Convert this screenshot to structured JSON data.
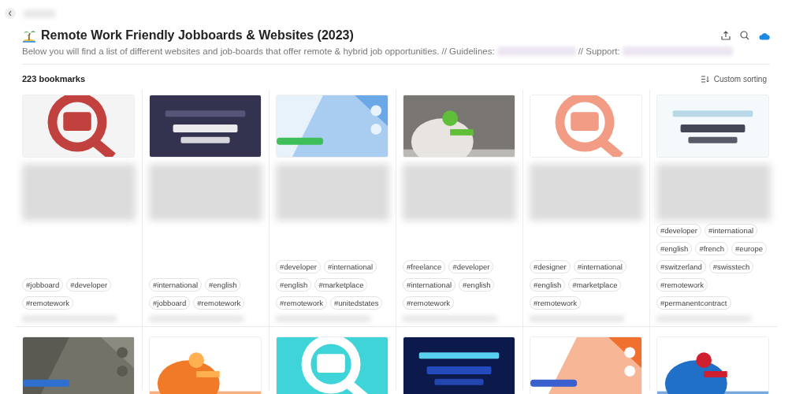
{
  "header": {
    "title": "Remote Work Friendly Jobboards & Websites (2023)",
    "description": "Below you will find a list of different websites and job-boards that offer remote & hybrid job opportunities.",
    "guidelines_label": "// Guidelines:",
    "support_label": "// Support:"
  },
  "toolbar": {
    "count": "223 bookmarks",
    "sort_label": "Custom sorting"
  },
  "rows": [
    {
      "bookmarks": [
        {
          "thumbnail": {
            "kind": "picture"
          },
          "tags": [
            "#jobboard",
            "#developer",
            "#remotework"
          ]
        },
        {
          "thumbnail": {
            "kind": "picture"
          },
          "tags": [
            "#international",
            "#english",
            "#jobboard",
            "#remotework"
          ]
        },
        {
          "thumbnail": {
            "kind": "picture"
          },
          "tags": [
            "#developer",
            "#international",
            "#english",
            "#marketplace",
            "#remotework",
            "#unitedstates"
          ]
        },
        {
          "thumbnail": {
            "kind": "picture"
          },
          "tags": [
            "#freelance",
            "#developer",
            "#international",
            "#english",
            "#remotework"
          ]
        },
        {
          "thumbnail": {
            "kind": "picture"
          },
          "tags": [
            "#designer",
            "#international",
            "#english",
            "#marketplace",
            "#remotework"
          ]
        },
        {
          "thumbnail": {
            "kind": "picture"
          },
          "tags": [
            "#developer",
            "#international",
            "#english",
            "#french",
            "#europe",
            "#switzerland",
            "#swisstech",
            "#remotework",
            "#permanentcontract"
          ]
        }
      ]
    },
    {
      "bookmarks": [
        {
          "thumbnail": {
            "kind": "picture"
          }
        },
        {
          "thumbnail": {
            "kind": "picture"
          }
        },
        {
          "thumbnail": {
            "kind": "picture"
          }
        },
        {
          "thumbnail": {
            "kind": "picture"
          }
        },
        {
          "thumbnail": {
            "kind": "picture"
          }
        },
        {
          "thumbnail": {
            "kind": "picture"
          }
        }
      ]
    }
  ]
}
